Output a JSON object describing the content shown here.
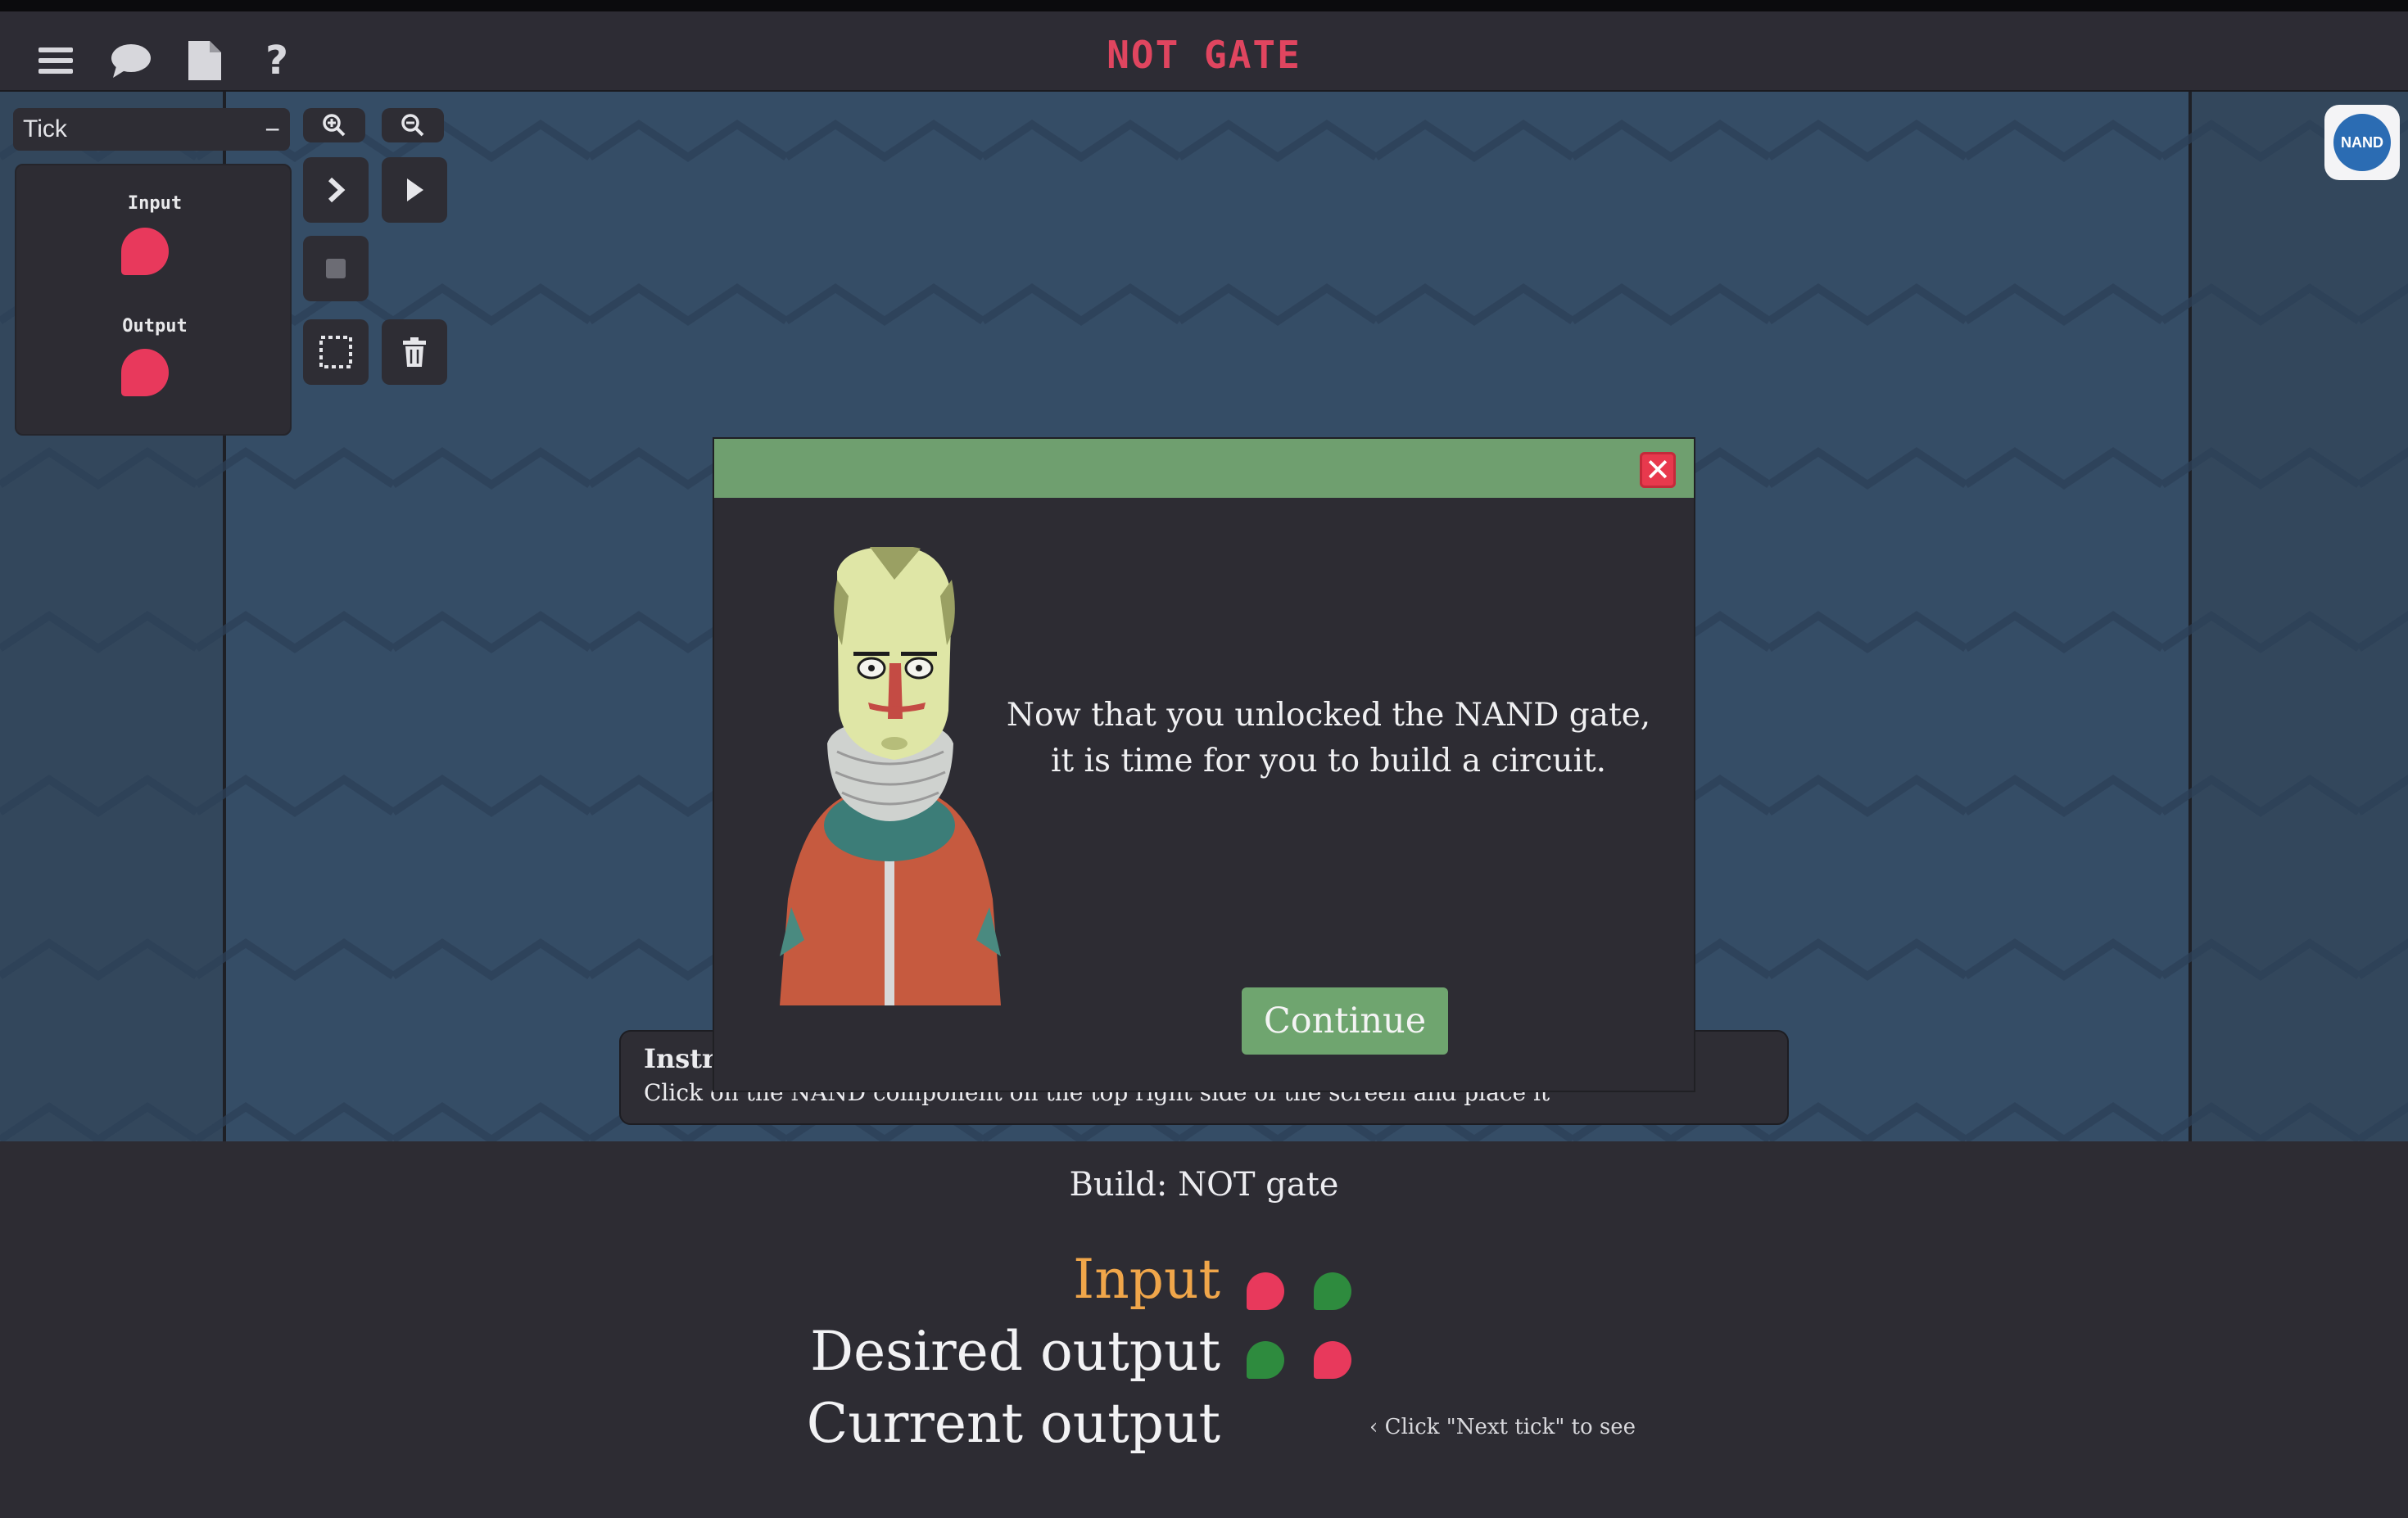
{
  "header": {
    "title": "NOT GATE",
    "icons": [
      "menu-icon",
      "chat-icon",
      "document-icon",
      "help-icon"
    ]
  },
  "speed_select": {
    "value": "Tick",
    "collapse_symbol": "−"
  },
  "io_panel": {
    "input_label": "Input",
    "output_label": "Output"
  },
  "toolbar": [
    "zoom-in",
    "zoom-out",
    "next-tick",
    "play",
    "stop",
    "select",
    "delete"
  ],
  "component_chip": {
    "label": "NAND"
  },
  "instructions": {
    "heading": "Instru",
    "text": "Click on the NAND component on the top right side of the screen and place it"
  },
  "dialog": {
    "message": "Now that you unlocked the NAND gate, it is time for you to build a circuit.",
    "continue_label": "Continue",
    "close_symbol": "✕"
  },
  "goal": {
    "build_label": "Build: NOT gate",
    "input_label": "Input",
    "desired_label": "Desired output",
    "current_label": "Current output",
    "hint": "Click \"Next tick\" to see",
    "hint_arrow": "‹",
    "input_states": [
      "red",
      "green"
    ],
    "desired_states": [
      "green",
      "red"
    ]
  },
  "colors": {
    "on": "#2e8b3e",
    "off": "#e8395c",
    "title": "#e0455f",
    "accent": "#f0a64a",
    "dialog_header": "#6f9f6f"
  }
}
